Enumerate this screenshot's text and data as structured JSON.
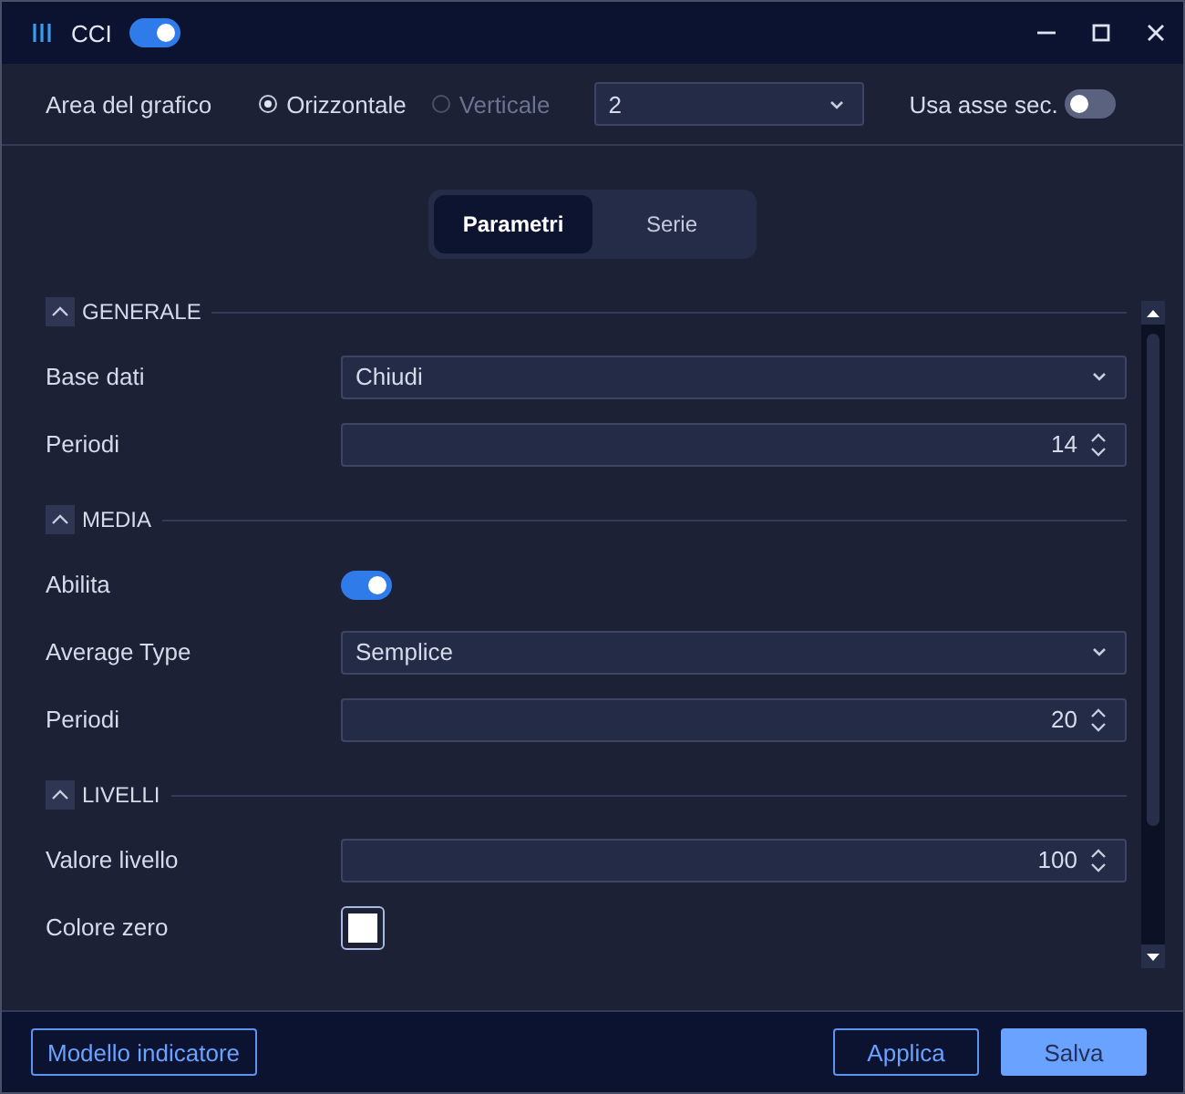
{
  "window": {
    "title": "CCI",
    "enabled": true
  },
  "chart_area": {
    "label": "Area del grafico",
    "options": [
      {
        "label": "Orizzontale",
        "selected": true,
        "disabled": false
      },
      {
        "label": "Verticale",
        "selected": false,
        "disabled": true
      }
    ],
    "pane": "2",
    "secondary_axis": {
      "label": "Usa asse sec.",
      "on": false
    }
  },
  "tabs": [
    {
      "label": "Parametri",
      "selected": true
    },
    {
      "label": "Serie",
      "selected": false
    }
  ],
  "sections": [
    {
      "title": "GENERALE",
      "expanded": true,
      "rows": [
        {
          "kind": "select",
          "label": "Base dati",
          "value": "Chiudi"
        },
        {
          "kind": "number",
          "label": "Periodi",
          "value": "14"
        }
      ]
    },
    {
      "title": "MEDIA",
      "expanded": true,
      "rows": [
        {
          "kind": "toggle",
          "label": "Abilita",
          "on": true
        },
        {
          "kind": "select",
          "label": "Average Type",
          "value": "Semplice"
        },
        {
          "kind": "number",
          "label": "Periodi",
          "value": "20"
        }
      ]
    },
    {
      "title": "LIVELLI",
      "expanded": true,
      "rows": [
        {
          "kind": "number",
          "label": "Valore livello",
          "value": "100"
        },
        {
          "kind": "color",
          "label": "Colore zero",
          "color": "#ffffff"
        }
      ]
    }
  ],
  "footer": {
    "template_button": "Modello indicatore",
    "buttons": [
      {
        "label": "Applica",
        "kind": "secondary"
      },
      {
        "label": "Salva",
        "kind": "primary"
      }
    ]
  }
}
